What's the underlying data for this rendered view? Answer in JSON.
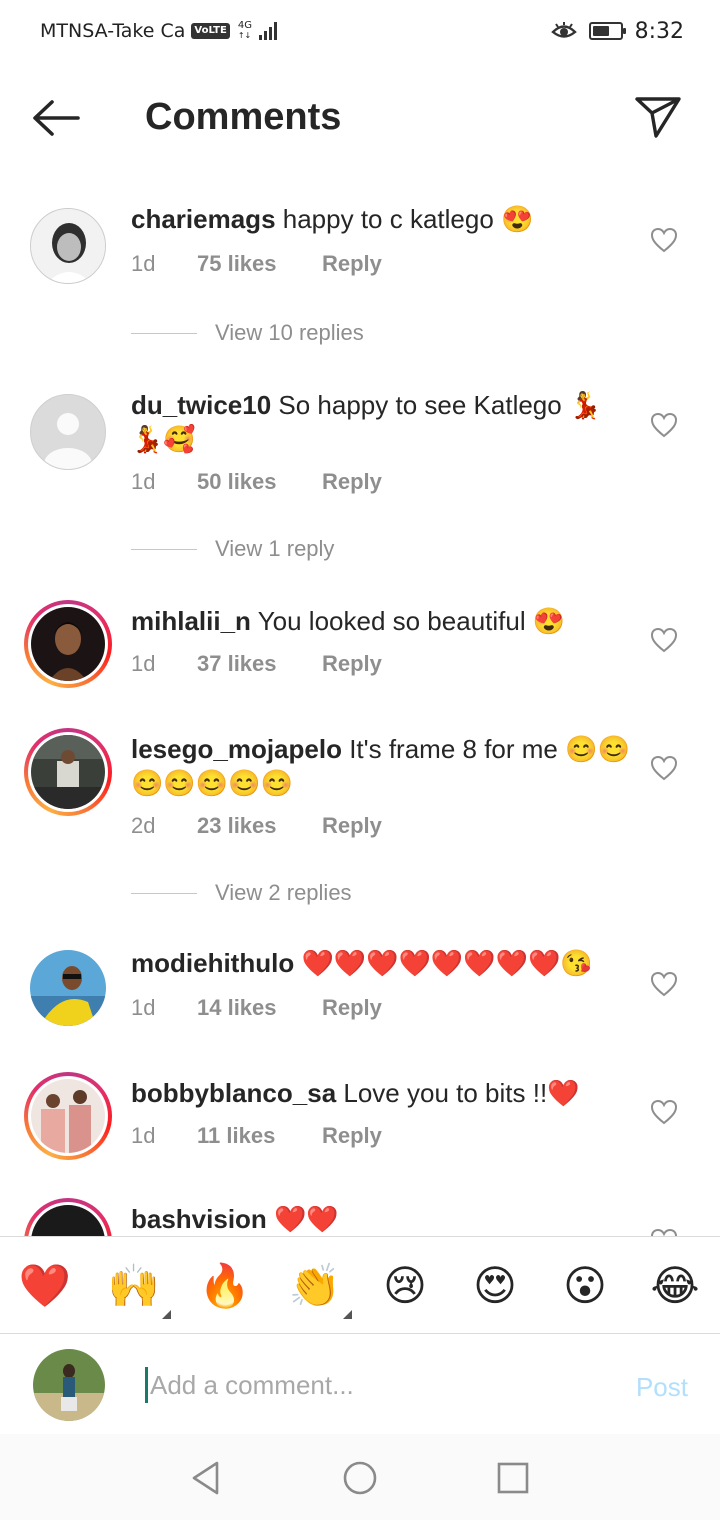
{
  "status_bar": {
    "carrier": "MTNSA-Take Ca",
    "volte": "VoLTE",
    "network": "4G",
    "time": "8:32",
    "battery_level": 0.6
  },
  "header": {
    "title": "Comments",
    "back_icon": "arrow-left-icon",
    "share_icon": "paper-plane-icon"
  },
  "comments": [
    {
      "username": "chariemags",
      "text": "happy to c katlego 😍",
      "time": "1d",
      "likes": "75 likes",
      "reply": "Reply",
      "view_replies": "View 10 replies",
      "story_ring": false
    },
    {
      "username": "du_twice10",
      "text": "So happy to see Katlego 💃💃🥰",
      "time": "1d",
      "likes": "50 likes",
      "reply": "Reply",
      "view_replies": "View 1 reply",
      "story_ring": false
    },
    {
      "username": "mihlalii_n",
      "text": "You looked so beautiful 😍",
      "time": "1d",
      "likes": "37 likes",
      "reply": "Reply",
      "story_ring": true
    },
    {
      "username": "lesego_mojapelo",
      "text": "It's frame 8 for me 😊😊😊😊😊😊😊",
      "time": "2d",
      "likes": "23 likes",
      "reply": "Reply",
      "view_replies": "View 2 replies",
      "story_ring": true
    },
    {
      "username": "modiehithulo",
      "text": "❤️❤️❤️❤️❤️❤️❤️❤️😘",
      "time": "1d",
      "likes": "14 likes",
      "reply": "Reply",
      "story_ring": false
    },
    {
      "username": "bobbyblanco_sa",
      "text": "Love you to bits !!❤️",
      "time": "1d",
      "likes": "11 likes",
      "reply": "Reply",
      "story_ring": true
    },
    {
      "username": "bashvision",
      "text": "❤️❤️",
      "story_ring": true
    }
  ],
  "emoji_bar": [
    "❤️",
    "🙌",
    "🔥",
    "👏",
    "😢",
    "😍",
    "😮",
    "😂"
  ],
  "comment_input": {
    "placeholder": "Add a comment...",
    "post_label": "Post"
  },
  "nav_bar": {
    "back_icon": "triangle-back-icon",
    "home_icon": "circle-home-icon",
    "recents_icon": "square-recents-icon"
  }
}
